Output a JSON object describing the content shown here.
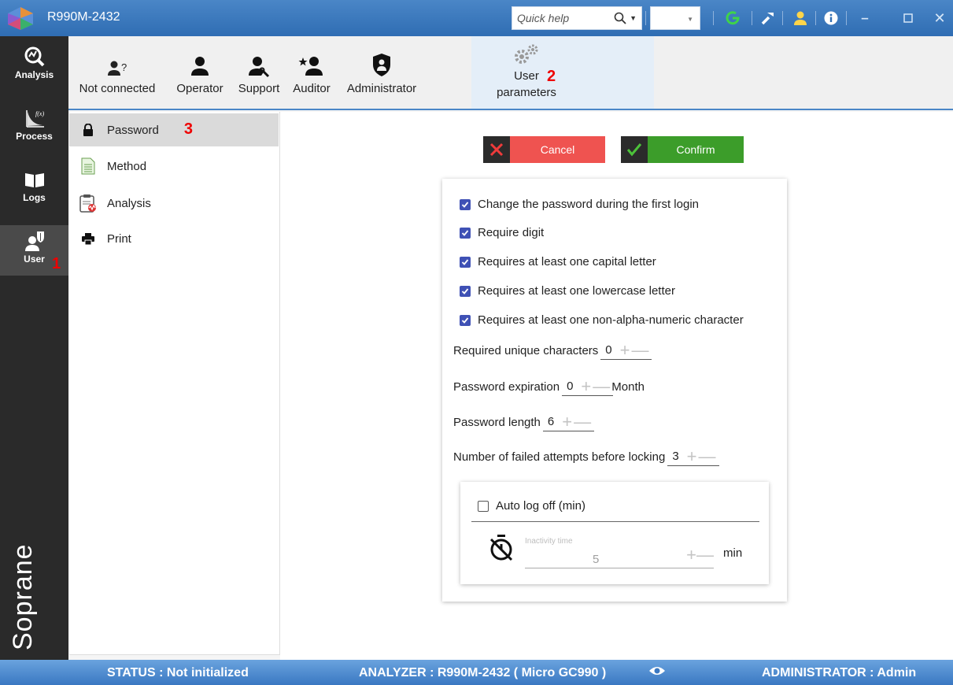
{
  "window": {
    "title": "R990M-2432"
  },
  "titlebar": {
    "quick_help_placeholder": "Quick help",
    "combo_value": ""
  },
  "leftnav": {
    "items": [
      {
        "label": "Analysis",
        "icon": "analysis-icon"
      },
      {
        "label": "Process",
        "icon": "process-icon"
      },
      {
        "label": "Logs",
        "icon": "logs-icon"
      },
      {
        "label": "User",
        "icon": "user-icon",
        "active": true
      }
    ],
    "brand": "Soprane"
  },
  "toolbar": {
    "roles": [
      {
        "label": "Not connected",
        "icon": "not-connected-icon"
      },
      {
        "label": "Operator",
        "icon": "operator-icon"
      },
      {
        "label": "Support",
        "icon": "support-icon"
      },
      {
        "label": "Auditor",
        "icon": "auditor-icon"
      },
      {
        "label": "Administrator",
        "icon": "administrator-icon"
      }
    ],
    "user_parameters": {
      "line1": "User",
      "line2": "parameters",
      "icon": "gears-icon"
    }
  },
  "annotations": {
    "n1": "1",
    "n2": "2",
    "n3": "3"
  },
  "submenu": {
    "items": [
      {
        "label": "Password",
        "icon": "lock-icon",
        "active": true
      },
      {
        "label": "Method",
        "icon": "method-icon"
      },
      {
        "label": "Analysis",
        "icon": "clipboard-icon"
      },
      {
        "label": "Print",
        "icon": "printer-icon"
      }
    ]
  },
  "actions": {
    "cancel": "Cancel",
    "confirm": "Confirm"
  },
  "password_settings": {
    "checks": [
      {
        "label": "Change the password during the first login",
        "checked": true
      },
      {
        "label": "Require digit",
        "checked": true
      },
      {
        "label": "Requires at least one capital letter",
        "checked": true
      },
      {
        "label": "Requires at least one lowercase letter",
        "checked": true
      },
      {
        "label": "Requires at least one non-alpha-numeric character",
        "checked": true
      }
    ],
    "unique_chars": {
      "label": "Required unique characters",
      "value": "0"
    },
    "expiration": {
      "label": "Password expiration",
      "value": "0",
      "unit": "Month"
    },
    "length": {
      "label": "Password length",
      "value": "6"
    },
    "failed_attempts": {
      "label": "Number of failed attempts before locking",
      "value": "3"
    },
    "auto_logoff": {
      "label": "Auto log off (min)",
      "checked": false,
      "inactivity_label": "Inactivity time",
      "inactivity_value": "5",
      "unit": "min"
    }
  },
  "statusbar": {
    "status": "STATUS :  Not initialized",
    "analyzer": "ANALYZER :  R990M-2432 ( Micro GC990 )",
    "admin": "ADMINISTRATOR  :  Admin"
  },
  "colors": {
    "accent": "#3f51b5",
    "cancel": "#ef5350",
    "confirm": "#3c9d2a",
    "titlebar": "#2f6db3",
    "annotation": "#e00000"
  }
}
